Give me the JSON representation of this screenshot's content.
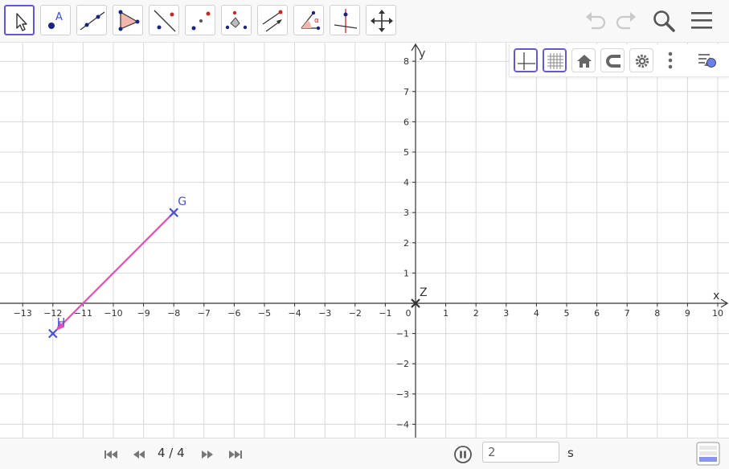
{
  "toolbar": {
    "tools": [
      {
        "name": "move-tool-icon",
        "selected": true
      },
      {
        "name": "point-tool-icon",
        "selected": false,
        "caption": "A"
      },
      {
        "name": "line-tool-icon",
        "selected": false
      },
      {
        "name": "polygon-tool-icon",
        "selected": false
      },
      {
        "name": "perpendicular-line-tool-icon",
        "selected": false
      },
      {
        "name": "midpoint-tool-icon",
        "selected": false
      },
      {
        "name": "circle-tool-icon",
        "selected": false
      },
      {
        "name": "vector-tool-icon",
        "selected": false
      },
      {
        "name": "angle-tool-icon",
        "selected": false,
        "caption": "α"
      },
      {
        "name": "reflect-tool-icon",
        "selected": false
      },
      {
        "name": "move-graphics-view-tool-icon",
        "selected": false
      }
    ],
    "right_icons": [
      "undo-icon",
      "redo-icon",
      "search-icon",
      "menu-icon"
    ]
  },
  "style_bar": {
    "buttons": [
      "show-axes-icon",
      "show-grid-icon",
      "home-icon",
      "snap-magnet-icon",
      "settings-gear-icon",
      "more-vertical-icon",
      "toggle-style-bar-icon"
    ]
  },
  "graph": {
    "x_axis_label": "x",
    "y_axis_label": "y",
    "x_ticks": [
      "−13",
      "−12",
      "−11",
      "−10",
      "−9",
      "−8",
      "−7",
      "−6",
      "−5",
      "−4",
      "−3",
      "−2",
      "−1",
      "0",
      "1",
      "2",
      "3",
      "4",
      "5",
      "6",
      "7",
      "8",
      "9",
      "10"
    ],
    "y_ticks": [
      "8",
      "7",
      "6",
      "5",
      "4",
      "3",
      "2",
      "1",
      "−1",
      "−2",
      "−3",
      "−4"
    ],
    "points": [
      {
        "label": "G",
        "x": -8,
        "y": 3
      },
      {
        "label": "H",
        "x": -12,
        "y": -1
      },
      {
        "label": "Z",
        "x": 0,
        "y": 0
      }
    ],
    "vector": {
      "from": "G",
      "to": "H"
    },
    "colors": {
      "point": "#4b4fd6",
      "vector": "#e04fb8",
      "origin_point": "#333333",
      "grid": "#d8d8d8",
      "axis": "#333333"
    }
  },
  "playback": {
    "step_text": "4 / 4",
    "speed_value": "2",
    "speed_unit": "s",
    "buttons": [
      "skip-to-start-icon",
      "step-back-icon",
      "step-forward-icon",
      "skip-to-end-icon"
    ]
  }
}
